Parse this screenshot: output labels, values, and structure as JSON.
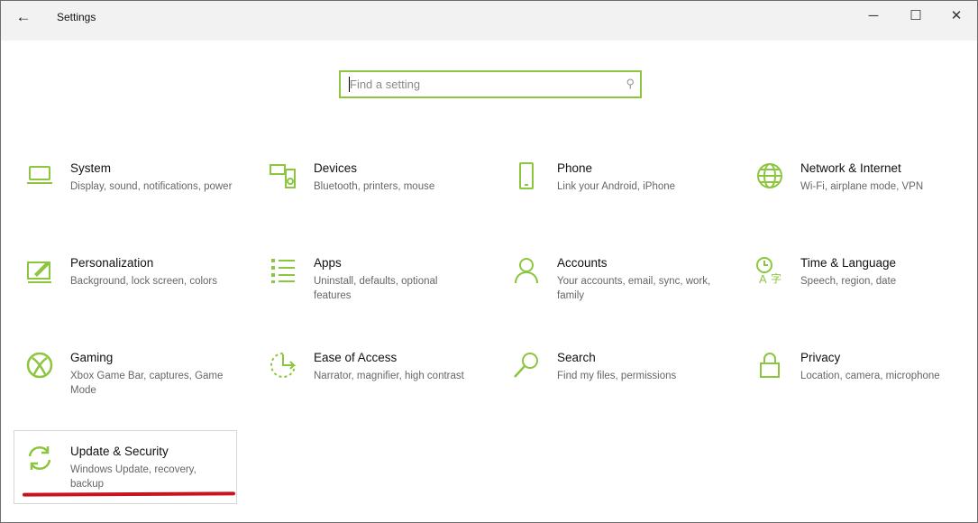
{
  "window": {
    "title": "Settings",
    "back_icon": "arrow-left-icon",
    "minimize": "─",
    "maximize": "☐",
    "close": "✕"
  },
  "search": {
    "placeholder": "Find a setting",
    "icon": "search-icon"
  },
  "accent": "#8cc63f",
  "highlight": "#c8141e",
  "tiles": [
    {
      "title": "System",
      "desc": "Display, sound, notifications, power",
      "icon": "laptop-icon"
    },
    {
      "title": "Devices",
      "desc": "Bluetooth, printers, mouse",
      "icon": "keyboard-speaker-icon"
    },
    {
      "title": "Phone",
      "desc": "Link your Android, iPhone",
      "icon": "phone-icon"
    },
    {
      "title": "Network & Internet",
      "desc": "Wi-Fi, airplane mode, VPN",
      "icon": "globe-icon"
    },
    {
      "title": "Personalization",
      "desc": "Background, lock screen, colors",
      "icon": "paint-icon"
    },
    {
      "title": "Apps",
      "desc": "Uninstall, defaults, optional features",
      "icon": "apps-list-icon"
    },
    {
      "title": "Accounts",
      "desc": "Your accounts, email, sync, work, family",
      "icon": "person-icon"
    },
    {
      "title": "Time & Language",
      "desc": "Speech, region, date",
      "icon": "time-language-icon"
    },
    {
      "title": "Gaming",
      "desc": "Xbox Game Bar, captures, Game Mode",
      "icon": "xbox-icon"
    },
    {
      "title": "Ease of Access",
      "desc": "Narrator, magnifier, high contrast",
      "icon": "ease-of-access-icon"
    },
    {
      "title": "Search",
      "desc": "Find my files, permissions",
      "icon": "search-icon"
    },
    {
      "title": "Privacy",
      "desc": "Location, camera, microphone",
      "icon": "lock-icon"
    },
    {
      "title": "Update & Security",
      "desc": "Windows Update, recovery, backup",
      "icon": "sync-icon"
    }
  ]
}
